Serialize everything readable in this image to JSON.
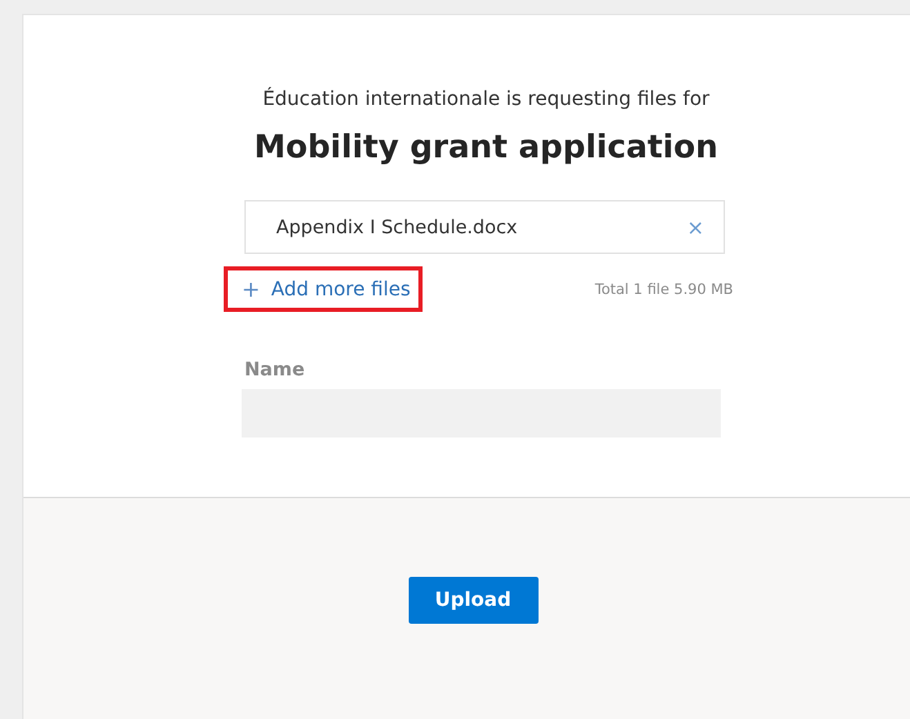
{
  "request": {
    "requester": "Éducation internationale is requesting files for",
    "title": "Mobility grant application"
  },
  "files": [
    {
      "name": "Appendix I Schedule.docx",
      "remove": "×"
    }
  ],
  "add_files": {
    "icon": "+",
    "label": "Add more files",
    "highlighted": true
  },
  "total": "Total 1 file  5.90 MB",
  "name_field": {
    "label": "Name"
  },
  "upload_button": "Upload"
}
